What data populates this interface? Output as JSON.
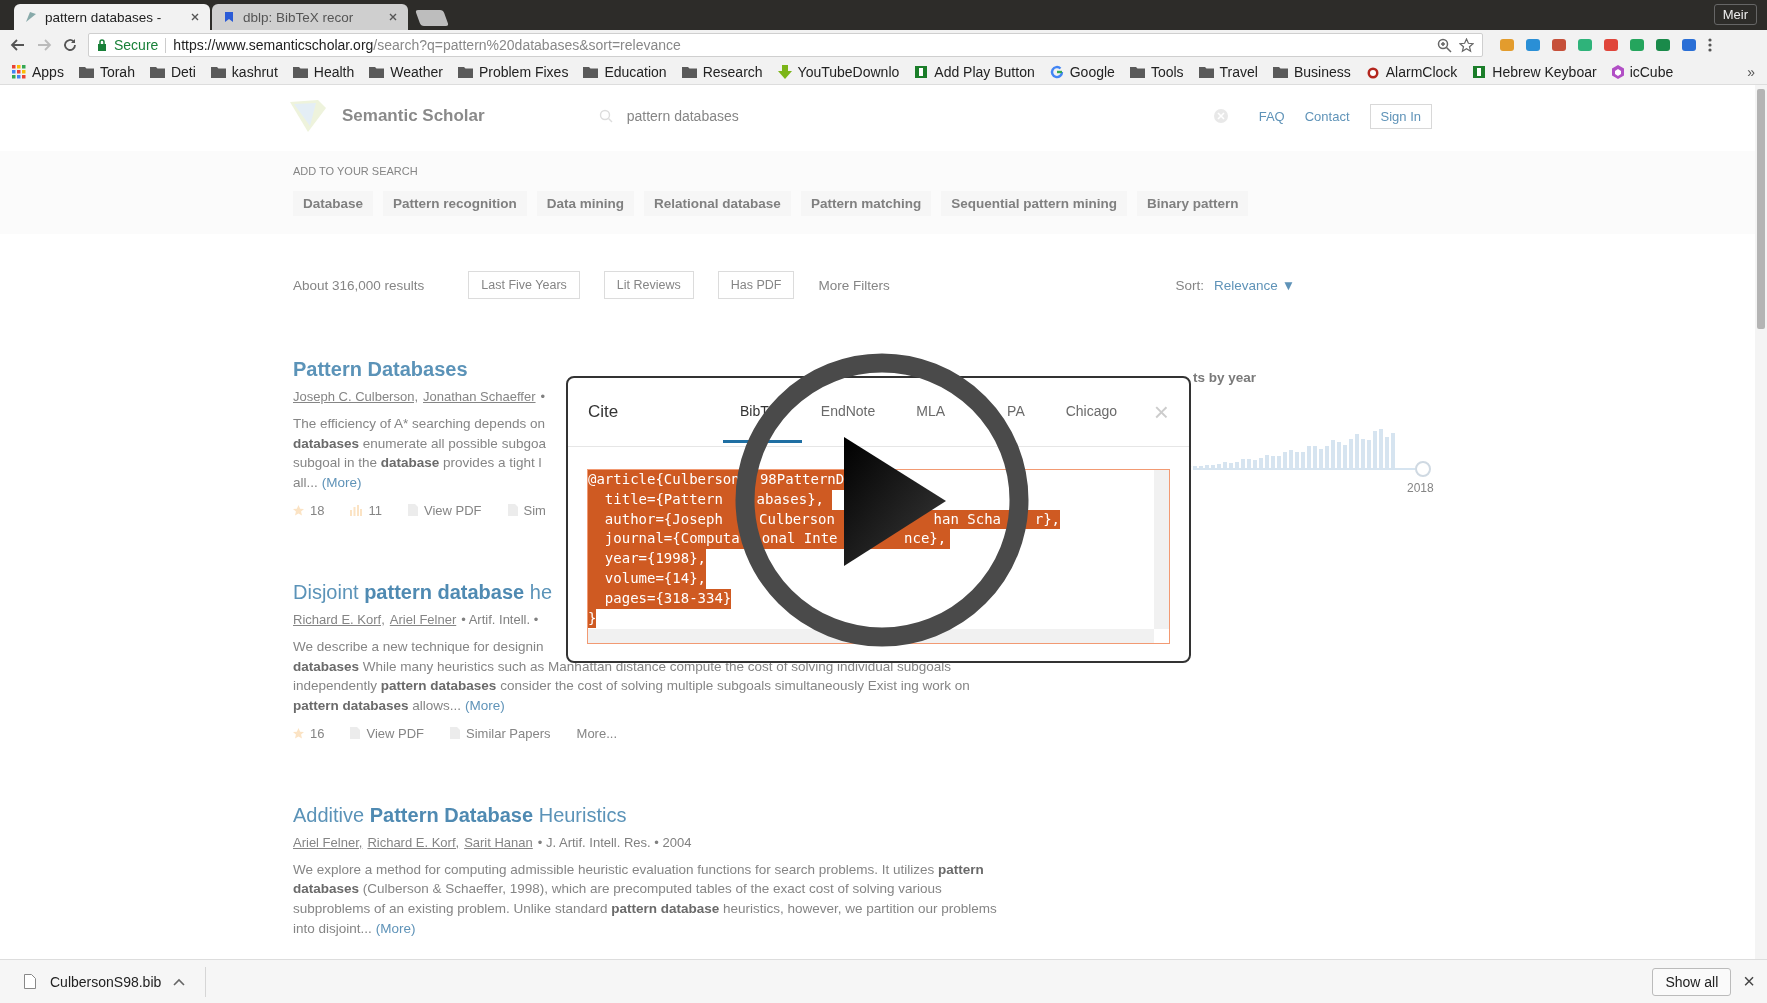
{
  "browser": {
    "tabs": [
      {
        "title": "pattern databases -",
        "selected": true
      },
      {
        "title": "dblp: BibTeX recor",
        "selected": false
      }
    ],
    "profile": "Meir",
    "url": {
      "secure_label": "Secure",
      "host": "https://www.semanticscholar.org",
      "path": "/search?q=pattern%20databases&sort=relevance"
    },
    "bookmarks": [
      {
        "label": "Apps",
        "kind": "apps"
      },
      {
        "label": "Torah",
        "kind": "folder"
      },
      {
        "label": "Deti",
        "kind": "folder"
      },
      {
        "label": "kashrut",
        "kind": "folder"
      },
      {
        "label": "Health",
        "kind": "folder"
      },
      {
        "label": "Weather",
        "kind": "folder"
      },
      {
        "label": "Problem Fixes",
        "kind": "folder"
      },
      {
        "label": "Education",
        "kind": "folder"
      },
      {
        "label": "Research",
        "kind": "folder"
      },
      {
        "label": "YouTubeDownlo",
        "kind": "download"
      },
      {
        "label": "Add Play Button",
        "kind": "page"
      },
      {
        "label": "Google",
        "kind": "google"
      },
      {
        "label": "Tools",
        "kind": "folder"
      },
      {
        "label": "Travel",
        "kind": "folder"
      },
      {
        "label": "Business",
        "kind": "folder"
      },
      {
        "label": "AlarmClock",
        "kind": "alarm"
      },
      {
        "label": "Hebrew Keyboar",
        "kind": "page"
      },
      {
        "label": "icCube",
        "kind": "cube"
      }
    ],
    "overflow": "»"
  },
  "site": {
    "brand": "Semantic Scholar",
    "search_value": "pattern databases",
    "nav": [
      {
        "label": "FAQ",
        "kind": "link"
      },
      {
        "label": "Contact",
        "kind": "link"
      },
      {
        "label": "Sign In",
        "kind": "button"
      }
    ],
    "suggest_label": "ADD TO YOUR SEARCH",
    "suggestions": [
      "Database",
      "Pattern recognition",
      "Data mining",
      "Relational database",
      "Pattern matching",
      "Sequential pattern mining",
      "Binary pattern"
    ],
    "result_count": "About 316,000 results",
    "filters": [
      "Last Five Years",
      "Lit Reviews",
      "Has PDF"
    ],
    "more_filters": "More Filters",
    "sort_label": "Sort:",
    "sort_value": "Relevance ▼"
  },
  "results": [
    {
      "title": "Pattern Databases",
      "authors": [
        "Joseph C. Culberson,",
        "Jonathan Schaeffer"
      ],
      "meta": "•",
      "abstract_lines": [
        "The efficiency of A* searching depends on",
        "**databases** enumerate all possible subgoa",
        "subgoal in the **database** provides a tight l",
        "all..."
      ],
      "more": "(More)",
      "stats": [
        {
          "kind": "star",
          "label": "18"
        },
        {
          "kind": "bars",
          "label": "11"
        },
        {
          "kind": "pdf",
          "label": "View PDF"
        },
        {
          "kind": "similar",
          "label": "Sim"
        }
      ]
    },
    {
      "title": "Disjoint **pattern database** he",
      "authors": [
        "Richard E. Korf,",
        "Ariel Felner"
      ],
      "meta": "• Artif. Intell. •",
      "abstract_lines": [
        "We describe a new technique for designin",
        "**databases** While many heuristics such as Manhattan distance compute the cost of solving individual subgoals",
        "independently **pattern databases** consider the cost of solving multiple subgoals simultaneously Exist ing work on",
        "**pattern databases** allows..."
      ],
      "more": "(More)",
      "stats": [
        {
          "kind": "star",
          "label": "16"
        },
        {
          "kind": "pdf",
          "label": "View PDF"
        },
        {
          "kind": "similar",
          "label": "Similar Papers"
        },
        {
          "kind": "more",
          "label": "More..."
        }
      ]
    },
    {
      "title": "Additive **Pattern Database** Heuristics",
      "authors": [
        "Ariel Felner,",
        "Richard E. Korf,",
        "Sarit Hanan"
      ],
      "meta": "• J. Artif. Intell. Res. • 2004",
      "abstract_lines": [
        "We explore a method for computing admissible heuristic evaluation functions for search problems. It utilizes **pattern**",
        "**databases** (Culberson & Schaeffer, 1998), which are precomputed tables of the exact cost of solving various",
        "subproblems of an existing problem. Unlike standard **pattern database** heuristics, however, we partition our problems",
        "into disjoint..."
      ],
      "more": "(More)"
    }
  ],
  "citations": {
    "title": "ts by year",
    "axis_label": "2018"
  },
  "modal": {
    "title": "Cite",
    "close": "×",
    "tabs": [
      {
        "label": "BibT",
        "selected": true
      },
      {
        "label": "EndNote",
        "selected": false
      },
      {
        "label": "MLA",
        "selected": false
      },
      {
        "label": "PA",
        "selected": false
      },
      {
        "label": "Chicago",
        "selected": false
      }
    ],
    "text_selected": true,
    "lines": [
      [
        "@article{Culberson",
        "98PatternD"
      ],
      [
        "  title={Pattern",
        "abases},"
      ],
      [
        "  author={Joseph",
        "Culberson",
        "han Scha",
        "r},"
      ],
      [
        "  journal={Computa",
        "onal Inte",
        "nce},"
      ],
      [
        "  year={1998},"
      ],
      [
        "  volume={14},"
      ],
      [
        "  pages={318-334}"
      ],
      [
        "}"
      ]
    ]
  },
  "player": {
    "paused": true
  },
  "downloads": {
    "file": "CulbersonS98.bib",
    "show_all": "Show all",
    "close": "×"
  }
}
